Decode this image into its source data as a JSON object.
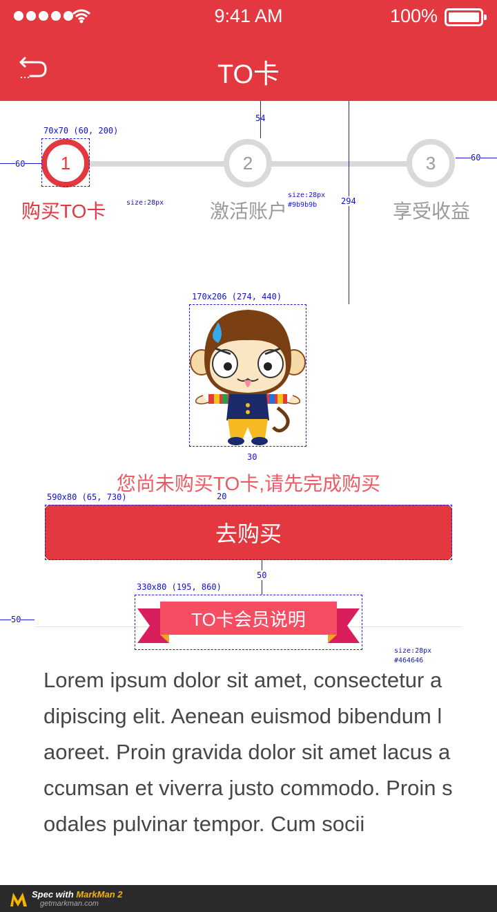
{
  "status_bar": {
    "time": "9:41 AM",
    "battery": "100%"
  },
  "header": {
    "title": "TO卡",
    "back_icon": "back-arrow-icon"
  },
  "steps": [
    {
      "number": "1",
      "label": "购买TO卡",
      "active": true
    },
    {
      "number": "2",
      "label": "激活账户",
      "active": false
    },
    {
      "number": "3",
      "label": "享受收益",
      "active": false
    }
  ],
  "mascot": {
    "icon": "monkey-mascot-illustration"
  },
  "empty_message": "您尚未购买TO卡,请先完成购买",
  "buy_button": "去购买",
  "ribbon_title": "TO卡会员说明",
  "body_text": "Lorem ipsum dolor sit amet, consectetur adipiscing elit. Aenean euismod bibendum laoreet. Proin gravida dolor sit amet lacus accumsan et viverra justo commodo. Proin sodales pulvinar tempor. Cum socii",
  "annotations": {
    "step_box": "70x70 (60, 200)",
    "top_gap": "54",
    "left_gap": "60",
    "right_gap": "60",
    "step_label_size": "size:28px",
    "step_label_size2": "size:28px",
    "step_label_color": "#9b9b9b",
    "vertical_gap": "294",
    "mascot_box": "170x206 (274, 440)",
    "mascot_gap": "30",
    "msg_gap": "20",
    "button_box": "590x80 (65, 730)",
    "button_gap": "50",
    "ribbon_box": "330x80 (195, 860)",
    "divider_gap": "50",
    "text_size": "size:28px",
    "text_color": "#464646"
  },
  "footer": {
    "spec_prefix": "Spec with ",
    "brand": "MarkMan 2",
    "site": "getmarkman.com"
  },
  "colors": {
    "primary": "#e3383f",
    "inactive": "#9b9b9b",
    "text": "#464646",
    "message": "#ef5a62"
  }
}
